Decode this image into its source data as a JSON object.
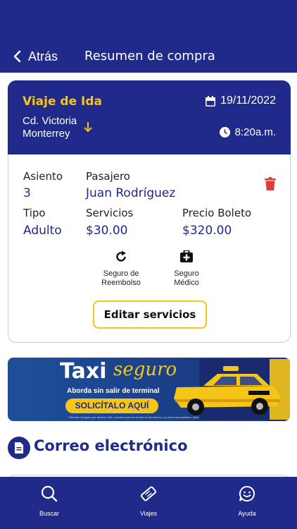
{
  "header": {
    "back_label": "Atrás",
    "title": "Resumen de compra"
  },
  "trip": {
    "type": "Viaje de Ida",
    "origin": "Cd. Victoria",
    "destination": "Monterrey",
    "date": "19/11/2022",
    "time": "8:20a.m."
  },
  "ticket": {
    "seat_label": "Asiento",
    "seat_value": "3",
    "passenger_label": "Pasajero",
    "passenger_value": "Juan Rodríguez",
    "type_label": "Tipo",
    "type_value": "Adulto",
    "services_label": "Servicios",
    "services_value": "$30.00",
    "price_label": "Precio Boleto",
    "price_value": "$320.00"
  },
  "services": [
    {
      "line1": "Seguro de",
      "line2": "Reembolso",
      "icon": "refresh-icon"
    },
    {
      "line1": "Seguro",
      "line2": "Médico",
      "icon": "medical-kit-icon"
    }
  ],
  "edit_button": "Editar servicios",
  "banner": {
    "brand_taxi": "Taxi",
    "brand_seguro": "seguro",
    "subtitle": "Aborda sin salir de terminal",
    "cta": "SOLICÍTALO AQUÍ",
    "fine_print": "*Servicio otorgado por Modero Suit, exclusivo para la ciudad de Monterrey y su área metropolitana. Aplican restricciones."
  },
  "email_section": {
    "title": "Correo electrónico"
  },
  "tabs": [
    {
      "label": "Buscar",
      "icon": "search-icon"
    },
    {
      "label": "Viajes",
      "icon": "ticket-icon"
    },
    {
      "label": "Ayuda",
      "icon": "chat-smile-icon"
    }
  ],
  "colors": {
    "primary": "#1f2a8a",
    "accent": "#f5c518",
    "danger": "#e53935"
  }
}
